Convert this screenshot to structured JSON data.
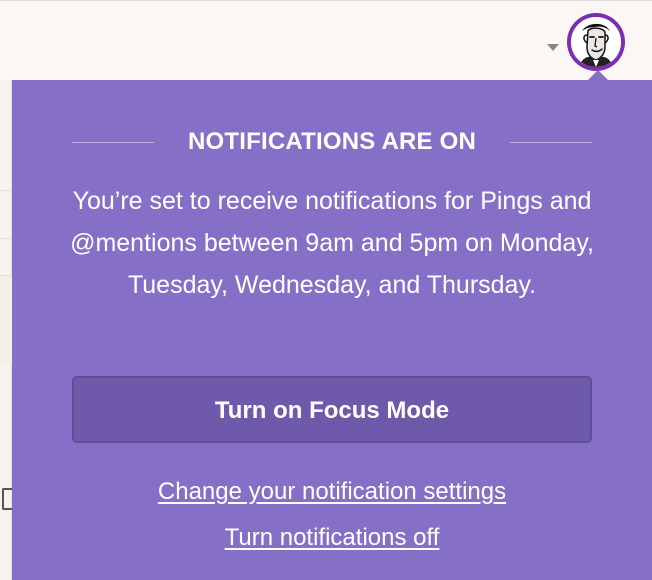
{
  "notifications_popover": {
    "title": "NOTIFICATIONS ARE ON",
    "message": "You’re set to receive notifications for Pings and @mentions between 9am and 5pm on Monday, Tuesday, Wednesday, and Thursday.",
    "focus_button_label": "Turn on Focus Mode",
    "settings_link_label": "Change your notification settings",
    "turn_off_link_label": "Turn notifications off"
  },
  "header": {
    "dropdown_icon": "chevron-down-icon",
    "avatar_icon": "user-avatar"
  },
  "colors": {
    "popover_background": "#866fc7",
    "button_background": "#6e59aa",
    "avatar_ring": "#7b2eb1",
    "text": "#ffffff"
  }
}
